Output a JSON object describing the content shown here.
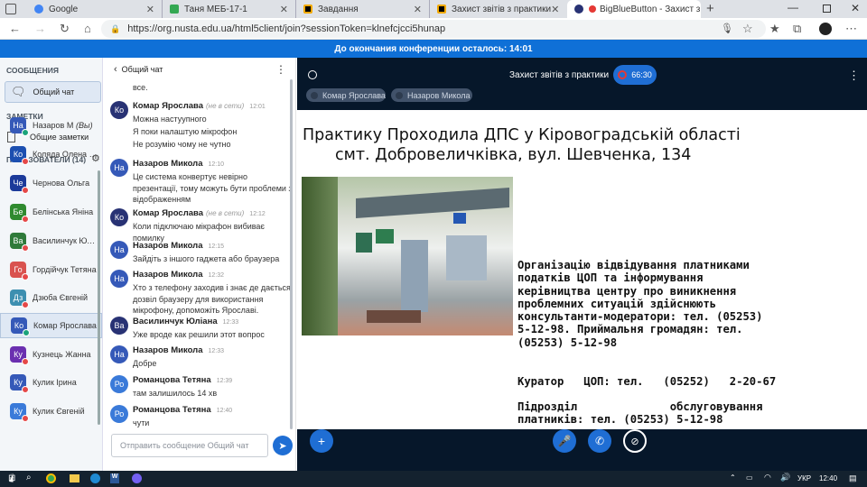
{
  "tabs": [
    {
      "label": "Google",
      "color": "#4285f4"
    },
    {
      "label": "Таня МЕБ-17-1",
      "color": "#34a853"
    },
    {
      "label": "Завдання",
      "color": "#000000"
    },
    {
      "label": "Захист звітів з практики",
      "color": "#000000"
    },
    {
      "label": "BigBlueButton - Захист зві...",
      "color": "#283274"
    }
  ],
  "address": {
    "url": "https://org.nusta.edu.ua/html5client/join?sessionToken=klnefcjcci5hunap"
  },
  "banner": {
    "text": "До окончания конференции осталось: 14:01"
  },
  "sidebar": {
    "messages_header": "СООБЩЕНИЯ",
    "public_chat": "Общий чат",
    "notes_header": "ЗАМЕТКИ",
    "shared_notes": "Общие заметки",
    "users_header": "ПОЛЬЗОВАТЕЛИ (14)",
    "users": [
      {
        "initials": "На",
        "name": "Назаров Мик...",
        "suffix": "(Вы)",
        "color": "#3559b8",
        "status": "#1aa37a"
      },
      {
        "initials": "Ко",
        "name": "Коляда Олена Во...",
        "color": "#1c4fb0",
        "status": "#e54848"
      },
      {
        "initials": "Че",
        "name": "Чернова Ольга",
        "color": "#1c3a9a",
        "status": "#e54848"
      },
      {
        "initials": "Бе",
        "name": "Белінська Яніна",
        "color": "#2f8a2f",
        "status": "#e54848"
      },
      {
        "initials": "Ва",
        "name": "Василинчук Юліа...",
        "color": "#2f7a3a",
        "status": "#e54848"
      },
      {
        "initials": "Го",
        "name": "Гордійчук Тетяна",
        "color": "#d9534f",
        "status": "#e54848"
      },
      {
        "initials": "Дз",
        "name": "Дзюба Євгеній",
        "color": "#3d8fb0",
        "status": "#e54848"
      },
      {
        "initials": "Ко",
        "name": "Комар Ярослава",
        "color": "#3559b8",
        "status": "#1aa37a"
      },
      {
        "initials": "Ку",
        "name": "Кузнець Жанна",
        "color": "#6b2fb0",
        "status": "#e54848"
      },
      {
        "initials": "Ку",
        "name": "Кулик Ірина",
        "color": "#3559b8",
        "status": "#e54848"
      },
      {
        "initials": "Ку",
        "name": "Кулик Євгеній",
        "color": "#3a7ad9",
        "status": "#e54848"
      }
    ]
  },
  "chat": {
    "title": "Общий чат",
    "partial_top": "все.",
    "messages": [
      {
        "initials": "Ко",
        "name": "Комар Ярослава",
        "note": "(не в сети)",
        "time": "12:01",
        "color": "#283274",
        "lines": [
          "Можна настуупного",
          "Я поки налаштую мікрофон",
          "Не розумію чому не чутно"
        ]
      },
      {
        "initials": "На",
        "name": "Назаров Микола",
        "time": "12:10",
        "color": "#3559b8",
        "lines": [
          "Це система конвертує невірно презентації, тому можуть бути проблеми з відображенням"
        ]
      },
      {
        "initials": "Ко",
        "name": "Комар Ярослава",
        "note": "(не в сети)",
        "time": "12:12",
        "color": "#283274",
        "lines": [
          "Коли підключаю мікрафон вибиває помилку"
        ]
      },
      {
        "initials": "На",
        "name": "Назаров Микола",
        "time": "12:15",
        "color": "#3559b8",
        "lines": [
          "Зайдіть з іншого гаджета або браузера"
        ]
      },
      {
        "initials": "На",
        "name": "Назаров Микола",
        "time": "12:32",
        "color": "#3559b8",
        "lines": [
          "Хто з телефону заходив і знає де дається дозвіл браузеру для використання мікрофону, допоможіть Ярославі."
        ]
      },
      {
        "initials": "Ва",
        "name": "Василинчук Юліана",
        "time": "12:33",
        "color": "#283274",
        "lines": [
          "Уже вроде как решили этот вопрос"
        ]
      },
      {
        "initials": "На",
        "name": "Назаров Микола",
        "time": "12:33",
        "color": "#3559b8",
        "lines": [
          "Добре"
        ]
      },
      {
        "initials": "Ро",
        "name": "Романцова Тетяна",
        "time": "12:39",
        "color": "#3a7ad9",
        "lines": [
          "там залишилось 14 хв"
        ]
      },
      {
        "initials": "Ро",
        "name": "Романцова Тетяна",
        "time": "12:40",
        "color": "#3a7ad9",
        "lines": [
          "чути"
        ]
      }
    ],
    "input_placeholder": "Отправить сообщение Общий чат"
  },
  "stage": {
    "title": "Захист звітів з практики",
    "timer": "66:30",
    "talkers": [
      "Комар Ярослава",
      "Назаров Микола"
    ]
  },
  "slide": {
    "heading1": "Практику Проходила ДПС у Кіровоградській області",
    "heading2": "смт. Добровеличківка, вул. Шевченка, 134",
    "body": "Організацію відвідування платниками податків ЦОП та інформування керівництва центру про виникнення проблемних ситуацій здійснюють консультанти-модератори: тел. (05253) 5-12-98. Приймальня громадян: тел. (05253) 5-12-98",
    "curator": "Куратор   ЦОП: тел.   (05252)   2-20-67",
    "division": "Підрозділ              обслуговування платників: тел. (05253) 5-12-98"
  },
  "taskbar": {
    "lang": "УКР",
    "time": "12:40"
  }
}
